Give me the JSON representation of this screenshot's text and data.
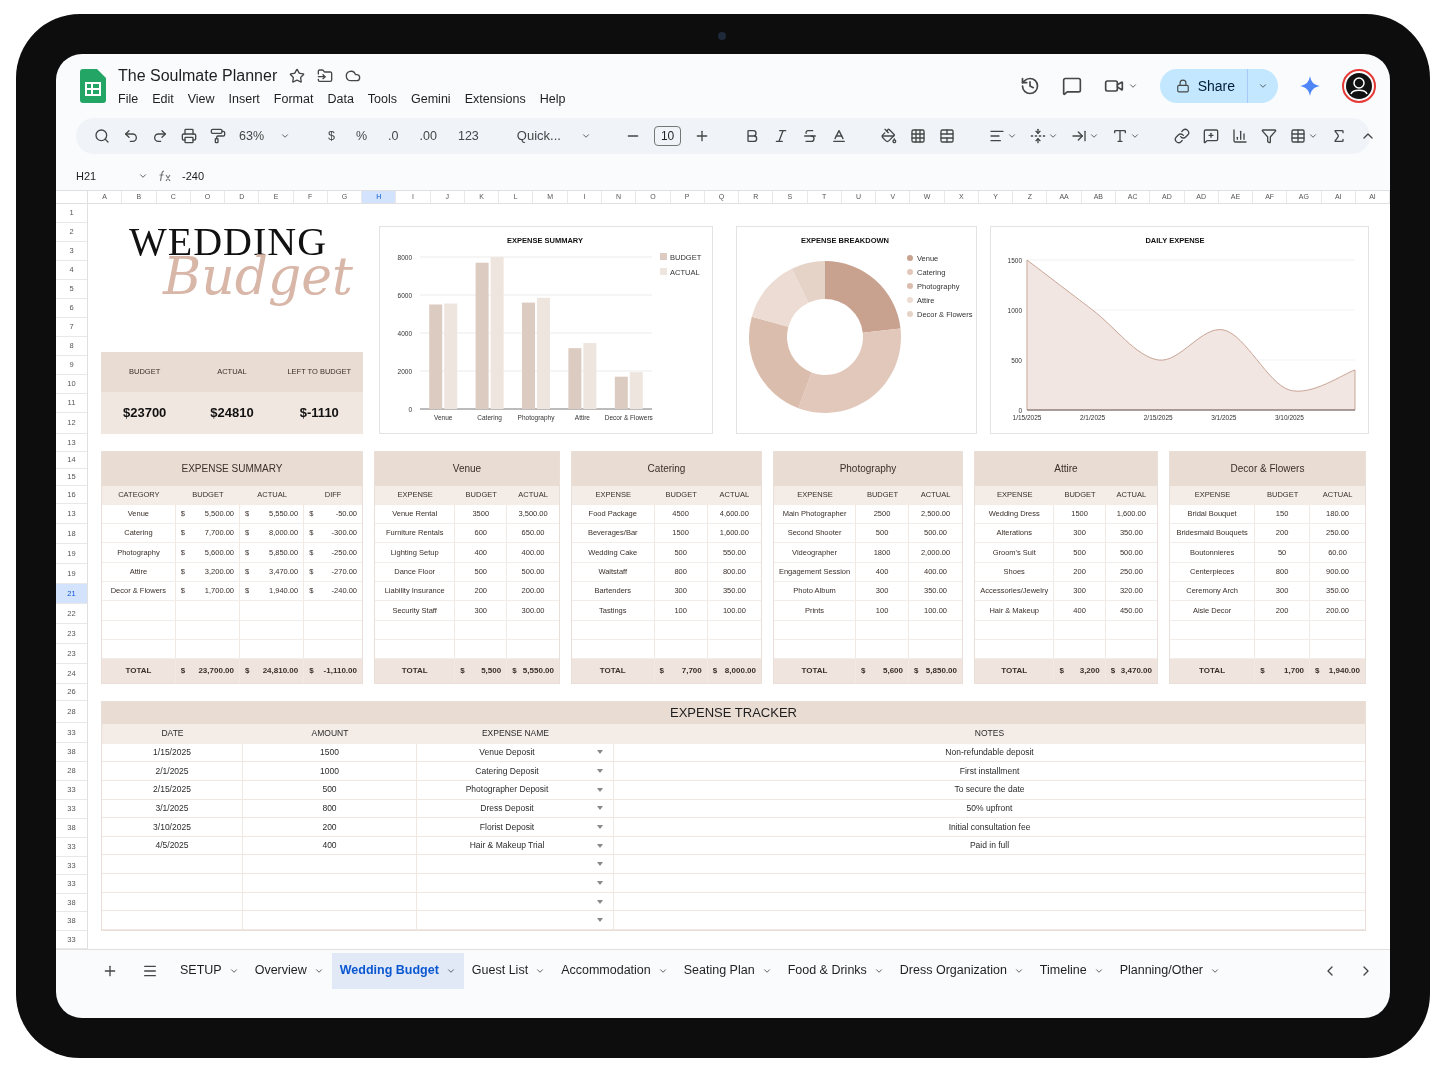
{
  "document": {
    "title": "The Soulmate Planner"
  },
  "menu": [
    "File",
    "Edit",
    "View",
    "Insert",
    "Format",
    "Data",
    "Tools",
    "Gemini",
    "Extensions",
    "Help"
  ],
  "share_button": "Share",
  "toolbar": {
    "zoom": "63%",
    "currency": "$",
    "percent": "%",
    "decrease_decimal": ".0",
    "increase_decimal": ".00",
    "number_format": "123",
    "font": "Quick...",
    "font_size": "10"
  },
  "formula_bar": {
    "cell": "H21",
    "value": "-240"
  },
  "column_letters": [
    {
      "label": "A",
      "selected": false
    },
    {
      "label": "B",
      "selected": false
    },
    {
      "label": "C",
      "selected": false
    },
    {
      "label": "O",
      "selected": false
    },
    {
      "label": "D",
      "selected": false
    },
    {
      "label": "E",
      "selected": false
    },
    {
      "label": "F",
      "selected": false
    },
    {
      "label": "G",
      "selected": false
    },
    {
      "label": "H",
      "selected": true
    },
    {
      "label": "I",
      "selected": false
    },
    {
      "label": "J",
      "selected": false
    },
    {
      "label": "K",
      "selected": false
    },
    {
      "label": "L",
      "selected": false
    },
    {
      "label": "M",
      "selected": false
    },
    {
      "label": "I",
      "selected": false
    },
    {
      "label": "N",
      "selected": false
    },
    {
      "label": "O",
      "selected": false
    },
    {
      "label": "P",
      "selected": false
    },
    {
      "label": "Q",
      "selected": false
    },
    {
      "label": "R",
      "selected": false
    },
    {
      "label": "S",
      "selected": false
    },
    {
      "label": "T",
      "selected": false
    },
    {
      "label": "U",
      "selected": false
    },
    {
      "label": "V",
      "selected": false
    },
    {
      "label": "W",
      "selected": false
    },
    {
      "label": "X",
      "selected": false
    },
    {
      "label": "Y",
      "selected": false
    },
    {
      "label": "Z",
      "selected": false
    },
    {
      "label": "AA",
      "selected": false
    },
    {
      "label": "AB",
      "selected": false
    },
    {
      "label": "AC",
      "selected": false
    },
    {
      "label": "AD",
      "selected": false
    },
    {
      "label": "AD",
      "selected": false
    },
    {
      "label": "AE",
      "selected": false
    },
    {
      "label": "AF",
      "selected": false
    },
    {
      "label": "AG",
      "selected": false
    },
    {
      "label": "AI",
      "selected": false
    },
    {
      "label": "AI",
      "selected": false
    }
  ],
  "row_numbers": [
    {
      "label": "1",
      "selected": false
    },
    {
      "label": "2",
      "selected": false
    },
    {
      "label": "3",
      "selected": false
    },
    {
      "label": "4",
      "selected": false
    },
    {
      "label": "5",
      "selected": false
    },
    {
      "label": "6",
      "selected": false
    },
    {
      "label": "7",
      "selected": false
    },
    {
      "label": "8",
      "selected": false
    },
    {
      "label": "9",
      "selected": false
    },
    {
      "label": "10",
      "selected": false
    },
    {
      "label": "11",
      "selected": false
    },
    {
      "label": "12",
      "selected": false
    },
    {
      "label": "13",
      "selected": false
    },
    {
      "label": "14",
      "selected": false
    },
    {
      "label": "15",
      "selected": false
    },
    {
      "label": "16",
      "selected": false
    },
    {
      "label": "13",
      "selected": false
    },
    {
      "label": "18",
      "selected": false
    },
    {
      "label": "19",
      "selected": false
    },
    {
      "label": "19",
      "selected": false
    },
    {
      "label": "21",
      "selected": true
    },
    {
      "label": "22",
      "selected": false
    },
    {
      "label": "23",
      "selected": false
    },
    {
      "label": "23",
      "selected": false
    },
    {
      "label": "24",
      "selected": false
    },
    {
      "label": "26",
      "selected": false
    },
    {
      "label": "28",
      "selected": false
    },
    {
      "label": "33",
      "selected": false
    },
    {
      "label": "38",
      "selected": false
    },
    {
      "label": "28",
      "selected": false
    },
    {
      "label": "33",
      "selected": false
    },
    {
      "label": "33",
      "selected": false
    },
    {
      "label": "38",
      "selected": false
    },
    {
      "label": "33",
      "selected": false
    },
    {
      "label": "33",
      "selected": false
    },
    {
      "label": "33",
      "selected": false
    },
    {
      "label": "38",
      "selected": false
    },
    {
      "label": "38",
      "selected": false
    },
    {
      "label": "33",
      "selected": false
    }
  ],
  "heading": {
    "title": "WEDDING",
    "script": "Budget"
  },
  "budget_summary": [
    {
      "label": "BUDGET",
      "value": "$23700"
    },
    {
      "label": "ACTUAL",
      "value": "$24810"
    },
    {
      "label": "LEFT TO BUDGET",
      "value": "$-1110"
    }
  ],
  "bar_chart": {
    "chart_data": {
      "type": "bar",
      "title": "EXPENSE SUMMARY",
      "categories": [
        "Venue",
        "Catering",
        "Photography",
        "Attire",
        "Decor & Flowers"
      ],
      "series": [
        {
          "name": "BUDGET",
          "color": "#dccbc0",
          "values": [
            5500,
            7700,
            5600,
            3200,
            1700
          ]
        },
        {
          "name": "ACTUAL",
          "color": "#efe5df",
          "values": [
            5550,
            8000,
            5850,
            3470,
            1940
          ]
        }
      ],
      "ylim": [
        0,
        8000
      ],
      "yticks": [
        0,
        2000,
        4000,
        6000,
        8000
      ],
      "grid": true,
      "legend": "right"
    }
  },
  "donut_chart": {
    "chart_data": {
      "type": "donut",
      "title": "EXPENSE BREAKDOWN",
      "categories": [
        "Venue",
        "Catering",
        "Photography",
        "Attire",
        "Decor & Flowers"
      ],
      "values": [
        23.2,
        32.5,
        23.6,
        13.5,
        7.2
      ],
      "legend": "right"
    }
  },
  "area_chart": {
    "chart_data": {
      "type": "area",
      "title": "DAILY EXPENSE",
      "categories": [
        "1/15/2025",
        "2/1/2025",
        "2/15/2025",
        "3/1/2025",
        "3/10/2025",
        null
      ],
      "values": [
        1500,
        1000,
        500,
        800,
        200,
        400
      ],
      "ylim": [
        0,
        1500
      ],
      "yticks": [
        0,
        500,
        1000,
        1500
      ],
      "grid": true
    }
  },
  "expense_tables": [
    {
      "kind": "summary",
      "title": "EXPENSE SUMMARY",
      "columns": [
        "CATEGORY",
        "BUDGET",
        "ACTUAL",
        "DIFF"
      ],
      "rows": [
        [
          "Venue",
          {
            "symbol": "$",
            "amount": "5,500.00"
          },
          {
            "symbol": "$",
            "amount": "5,550.00"
          },
          {
            "symbol": "$",
            "amount": "-50.00"
          }
        ],
        [
          "Catering",
          {
            "symbol": "$",
            "amount": "7,700.00"
          },
          {
            "symbol": "$",
            "amount": "8,000.00"
          },
          {
            "symbol": "$",
            "amount": "-300.00"
          }
        ],
        [
          "Photography",
          {
            "symbol": "$",
            "amount": "5,600.00"
          },
          {
            "symbol": "$",
            "amount": "5,850.00"
          },
          {
            "symbol": "$",
            "amount": "-250.00"
          }
        ],
        [
          "Attire",
          {
            "symbol": "$",
            "amount": "3,200.00"
          },
          {
            "symbol": "$",
            "amount": "3,470.00"
          },
          {
            "symbol": "$",
            "amount": "-270.00"
          }
        ],
        [
          "Decor & Flowers",
          {
            "symbol": "$",
            "amount": "1,700.00"
          },
          {
            "symbol": "$",
            "amount": "1,940.00"
          },
          {
            "symbol": "$",
            "amount": "-240.00"
          }
        ]
      ],
      "total": [
        "TOTAL",
        {
          "symbol": "$",
          "amount": "23,700.00"
        },
        {
          "symbol": "$",
          "amount": "24,810.00"
        },
        {
          "symbol": "$",
          "amount": "-1,110.00"
        }
      ]
    },
    {
      "kind": "category",
      "title": "Venue",
      "columns": [
        "EXPENSE",
        "BUDGET",
        "ACTUAL"
      ],
      "rows": [
        [
          "Venue Rental",
          "3500",
          "3,500.00"
        ],
        [
          "Furniture Rentals",
          "600",
          "650.00"
        ],
        [
          "Lighting Setup",
          "400",
          "400.00"
        ],
        [
          "Dance Floor",
          "500",
          "500.00"
        ],
        [
          "Liability Insurance",
          "200",
          "200.00"
        ],
        [
          "Security Staff",
          "300",
          "300.00"
        ]
      ],
      "total": [
        "TOTAL",
        {
          "symbol": "$",
          "amount": "5,500"
        },
        {
          "symbol": "$",
          "amount": "5,550.00"
        }
      ]
    },
    {
      "kind": "category",
      "title": "Catering",
      "columns": [
        "EXPENSE",
        "BUDGET",
        "ACTUAL"
      ],
      "rows": [
        [
          "Food Package",
          "4500",
          "4,600.00"
        ],
        [
          "Beverages/Bar",
          "1500",
          "1,600.00"
        ],
        [
          "Wedding Cake",
          "500",
          "550.00"
        ],
        [
          "Waitstaff",
          "800",
          "800.00"
        ],
        [
          "Bartenders",
          "300",
          "350.00"
        ],
        [
          "Tastings",
          "100",
          "100.00"
        ]
      ],
      "total": [
        "TOTAL",
        {
          "symbol": "$",
          "amount": "7,700"
        },
        {
          "symbol": "$",
          "amount": "8,000.00"
        }
      ]
    },
    {
      "kind": "category",
      "title": "Photography",
      "columns": [
        "EXPENSE",
        "BUDGET",
        "ACTUAL"
      ],
      "rows": [
        [
          "Main Photographer",
          "2500",
          "2,500.00"
        ],
        [
          "Second Shooter",
          "500",
          "500.00"
        ],
        [
          "Videographer",
          "1800",
          "2,000.00"
        ],
        [
          "Engagement Session",
          "400",
          "400.00"
        ],
        [
          "Photo Album",
          "300",
          "350.00"
        ],
        [
          "Prints",
          "100",
          "100.00"
        ]
      ],
      "total": [
        "TOTAL",
        {
          "symbol": "$",
          "amount": "5,600"
        },
        {
          "symbol": "$",
          "amount": "5,850.00"
        }
      ]
    },
    {
      "kind": "category",
      "title": "Attire",
      "columns": [
        "EXPENSE",
        "BUDGET",
        "ACTUAL"
      ],
      "rows": [
        [
          "Wedding Dress",
          "1500",
          "1,600.00"
        ],
        [
          "Alterations",
          "300",
          "350.00"
        ],
        [
          "Groom's Suit",
          "500",
          "500.00"
        ],
        [
          "Shoes",
          "200",
          "250.00"
        ],
        [
          "Accessories/Jewelry",
          "300",
          "320.00"
        ],
        [
          "Hair & Makeup",
          "400",
          "450.00"
        ]
      ],
      "total": [
        "TOTAL",
        {
          "symbol": "$",
          "amount": "3,200"
        },
        {
          "symbol": "$",
          "amount": "3,470.00"
        }
      ]
    },
    {
      "kind": "category",
      "title": "Decor & Flowers",
      "columns": [
        "EXPENSE",
        "BUDGET",
        "ACTUAL"
      ],
      "rows": [
        [
          "Bridal Bouquet",
          "150",
          "180.00"
        ],
        [
          "Bridesmaid Bouquets",
          "200",
          "250.00"
        ],
        [
          "Boutonnieres",
          "50",
          "60.00"
        ],
        [
          "Centerpieces",
          "800",
          "900.00"
        ],
        [
          "Ceremony Arch",
          "300",
          "350.00"
        ],
        [
          "Aisle Decor",
          "200",
          "200.00"
        ]
      ],
      "total": [
        "TOTAL",
        {
          "symbol": "$",
          "amount": "1,700"
        },
        {
          "symbol": "$",
          "amount": "1,940.00"
        }
      ]
    }
  ],
  "expense_tracker": {
    "title": "EXPENSE TRACKER",
    "columns": [
      "DATE",
      "AMOUNT",
      "EXPENSE NAME",
      "NOTES"
    ],
    "rows": [
      {
        "date": "1/15/2025",
        "amount": "1500",
        "expense": "Venue Deposit",
        "notes": "Non-refundable deposit",
        "dropdown": true
      },
      {
        "date": "2/1/2025",
        "amount": "1000",
        "expense": "Catering Deposit",
        "notes": "First installment",
        "dropdown": true
      },
      {
        "date": "2/15/2025",
        "amount": "500",
        "expense": "Photographer Deposit",
        "notes": "To secure the date",
        "dropdown": true
      },
      {
        "date": "3/1/2025",
        "amount": "800",
        "expense": "Dress Deposit",
        "notes": "50% upfront",
        "dropdown": true
      },
      {
        "date": "3/10/2025",
        "amount": "200",
        "expense": "Florist Deposit",
        "notes": "Initial consultation fee",
        "dropdown": true
      },
      {
        "date": "4/5/2025",
        "amount": "400",
        "expense": "Hair & Makeup Trial",
        "notes": "Paid in full",
        "dropdown": true
      },
      {
        "dropdown": true
      },
      {
        "dropdown": true
      },
      {
        "dropdown": true
      },
      {
        "dropdown": true
      }
    ]
  },
  "sheet_tabs": [
    {
      "label": "SETUP",
      "selected": false
    },
    {
      "label": "Overview",
      "selected": false
    },
    {
      "label": "Wedding Budget",
      "selected": true
    },
    {
      "label": "Guest List",
      "selected": false
    },
    {
      "label": "Accommodation",
      "selected": false
    },
    {
      "label": "Seating Plan",
      "selected": false
    },
    {
      "label": "Food & Drinks",
      "selected": false
    },
    {
      "label": "Dress Organization",
      "selected": false
    },
    {
      "label": "Timeline",
      "selected": false
    },
    {
      "label": "Planning/Other",
      "selected": false
    }
  ]
}
